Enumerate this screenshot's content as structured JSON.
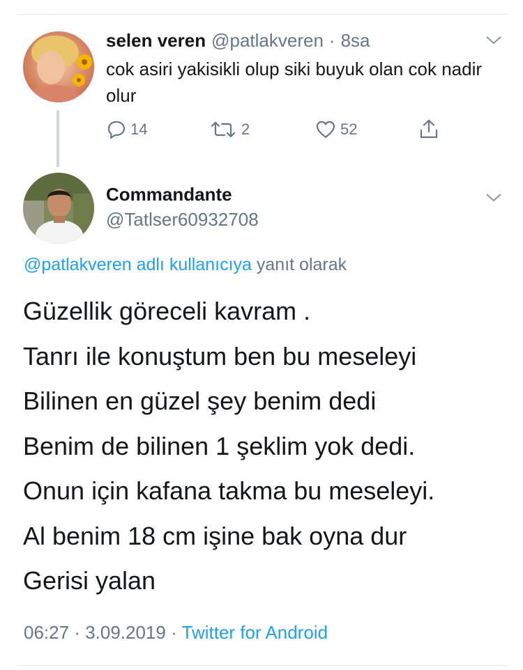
{
  "quoted_tweet": {
    "display_name": "selen veren",
    "handle": "@patlakveren",
    "separator": "·",
    "time": "8sa",
    "text": "cok asiri yakisikli olup siki buyuk olan cok nadir olur",
    "replies": "14",
    "retweets": "2",
    "likes": "52"
  },
  "main_tweet": {
    "display_name": "Commandante",
    "handle": "@Tatlser60932708",
    "reply_to_link": "@patlakveren adlı kullanıcıya",
    "reply_to_suffix": " yanıt olarak",
    "lines": [
      "Güzellik göreceli kavram .",
      "Tanrı ile konuştum ben bu meseleyi",
      "Bilinen en güzel şey benim dedi",
      "Benim de bilinen 1 şeklim yok dedi.",
      "Onun için kafana takma bu meseleyi.",
      "Al benim 18 cm işine bak oyna dur",
      "Gerisi yalan"
    ],
    "time": "06:27",
    "separator_1": " · ",
    "date": "3.09.2019",
    "separator_2": " · ",
    "source": "Twitter for Android"
  },
  "colors": {
    "link": "#1da1f2",
    "muted": "#657786",
    "text": "#14171a",
    "divider": "#e1e8ed"
  },
  "icons": [
    "reply-icon",
    "retweet-icon",
    "like-icon",
    "share-icon",
    "chevron-down-icon"
  ]
}
